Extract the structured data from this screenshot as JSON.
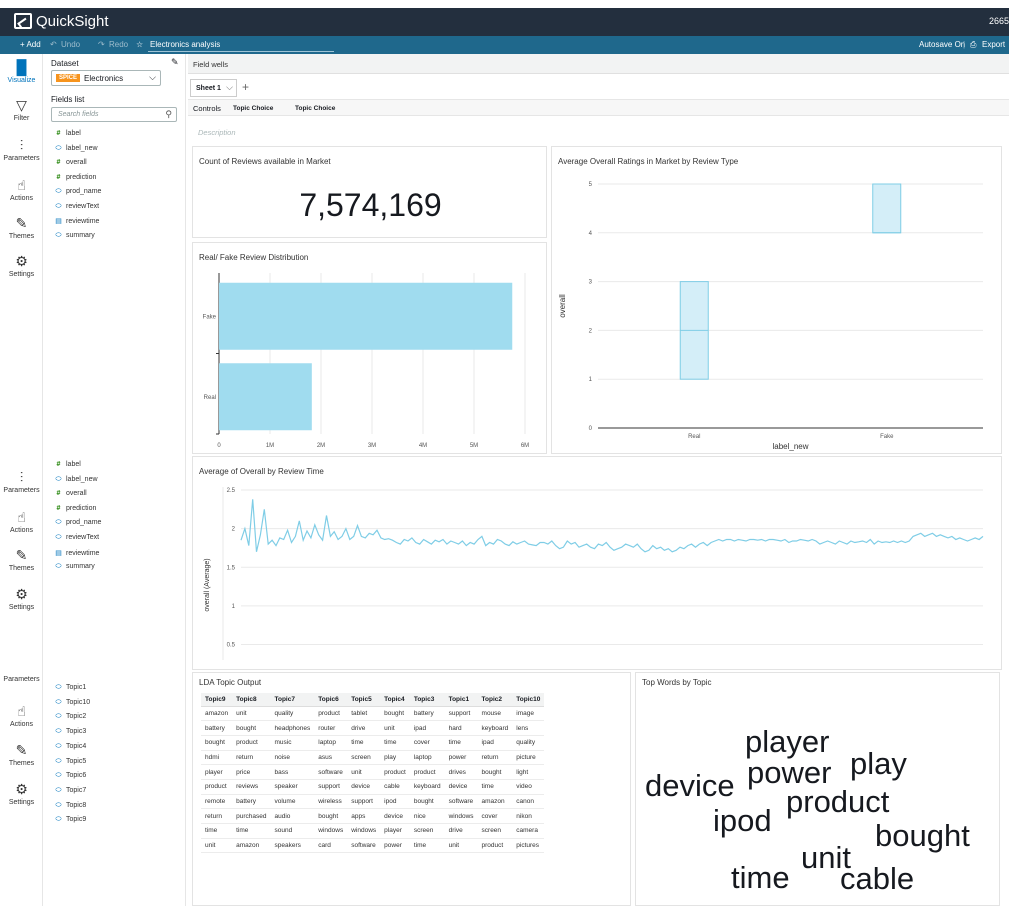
{
  "app": {
    "name": "QuickSight",
    "account": "2665"
  },
  "toolbar": {
    "add": "+ Add",
    "undo": "Undo",
    "redo": "Redo",
    "analysis_name": "Electronics analysis",
    "autosave": "Autosave On",
    "export": "Export"
  },
  "nav": [
    {
      "label": "Visualize",
      "icon": "visualize-icon"
    },
    {
      "label": "Filter",
      "icon": "filter-icon"
    },
    {
      "label": "Parameters",
      "icon": "parameters-icon"
    },
    {
      "label": "Actions",
      "icon": "actions-icon"
    },
    {
      "label": "Themes",
      "icon": "themes-icon"
    },
    {
      "label": "Settings",
      "icon": "settings-icon"
    }
  ],
  "dataset": {
    "label": "Dataset",
    "badge": "SPICE",
    "name": "Electronics"
  },
  "fields_list": {
    "label": "Fields list",
    "search_placeholder": "Search fields"
  },
  "fields": [
    {
      "name": "label",
      "type": "num"
    },
    {
      "name": "label_new",
      "type": "str"
    },
    {
      "name": "overall",
      "type": "num"
    },
    {
      "name": "prediction",
      "type": "num"
    },
    {
      "name": "prod_name",
      "type": "str"
    },
    {
      "name": "reviewText",
      "type": "str"
    },
    {
      "name": "reviewtime",
      "type": "date"
    },
    {
      "name": "summary",
      "type": "str"
    }
  ],
  "topic_fields": [
    {
      "name": "Topic1",
      "type": "str"
    },
    {
      "name": "Topic10",
      "type": "str"
    },
    {
      "name": "Topic2",
      "type": "str"
    },
    {
      "name": "Topic3",
      "type": "str"
    },
    {
      "name": "Topic4",
      "type": "str"
    },
    {
      "name": "Topic5",
      "type": "str"
    },
    {
      "name": "Topic6",
      "type": "str"
    },
    {
      "name": "Topic7",
      "type": "str"
    },
    {
      "name": "Topic8",
      "type": "str"
    },
    {
      "name": "Topic9",
      "type": "str"
    }
  ],
  "field_wells": "Field wells",
  "sheet": {
    "tab": "Sheet 1",
    "add": "+"
  },
  "controls": {
    "label": "Controls",
    "items": [
      "Topic Choice",
      "Topic Choice"
    ]
  },
  "description_placeholder": "Description",
  "colors": {
    "bar": "#a0dcef",
    "bar_stroke": "#7fcde6",
    "header": "#232f3e",
    "toolbar": "#1f688c",
    "spice": "#f7941d"
  },
  "kpi": {
    "title": "Count of Reviews available in Market",
    "value": "7,574,169"
  },
  "chart_data": [
    {
      "type": "bar",
      "orientation": "horizontal",
      "title": "Real/ Fake Review Distribution",
      "categories": [
        "Fake",
        "Real"
      ],
      "values": [
        5750000,
        1820000
      ],
      "xlim": [
        0,
        6000000
      ],
      "x_ticks": [
        "0",
        "1M",
        "2M",
        "3M",
        "4M",
        "5M",
        "6M"
      ],
      "grid": true
    },
    {
      "type": "boxplot",
      "title": "Average Overall Ratings in Market by Review Type",
      "xlabel": "label_new",
      "ylabel": "overall",
      "categories": [
        "Real",
        "Fake"
      ],
      "boxes": [
        {
          "q1": 1,
          "median": 2,
          "q3": 3
        },
        {
          "q1": 4,
          "median": 4,
          "q3": 5
        }
      ],
      "ylim": [
        0,
        5
      ],
      "y_ticks": [
        "0",
        "1",
        "2",
        "3",
        "4",
        "5"
      ],
      "grid": true
    },
    {
      "type": "line",
      "title": "Average of Overall by Review Time",
      "ylabel": "overall (Average)",
      "ylim": [
        0.3,
        2.5
      ],
      "y_ticks": [
        "0.5",
        "1",
        "1.5",
        "2",
        "2.5"
      ],
      "grid": true,
      "values": [
        1.85,
        2.0,
        1.78,
        2.38,
        1.7,
        1.92,
        2.25,
        1.8,
        1.85,
        1.78,
        1.88,
        1.86,
        1.98,
        1.82,
        1.9,
        2.1,
        1.85,
        1.97,
        1.88,
        2.05,
        1.92,
        1.85,
        2.17,
        1.9,
        1.96,
        1.86,
        1.9,
        2.0,
        1.86,
        1.9,
        2.04,
        1.9,
        1.88,
        1.94,
        1.92,
        1.98,
        1.88,
        1.86,
        1.87,
        1.85,
        1.82,
        1.8,
        1.86,
        1.84,
        1.88,
        1.82,
        1.8,
        1.86,
        1.83,
        1.8,
        1.85,
        1.83,
        1.86,
        1.8,
        1.84,
        1.82,
        1.8,
        1.84,
        1.78,
        1.82,
        1.8,
        1.86,
        1.9,
        1.78,
        1.82,
        1.8,
        1.86,
        1.84,
        1.8,
        1.78,
        1.83,
        1.8,
        1.82,
        1.84,
        1.8,
        1.79,
        1.78,
        1.82,
        1.82,
        1.8,
        1.84,
        1.78,
        1.74,
        1.76,
        1.84,
        1.8,
        1.82,
        1.76,
        1.78,
        1.8,
        1.76,
        1.74,
        1.8,
        1.78,
        1.82,
        1.76,
        1.72,
        1.74,
        1.76,
        1.8,
        1.78,
        1.76,
        1.8,
        1.74,
        1.7,
        1.72,
        1.78,
        1.74,
        1.76,
        1.72,
        1.74,
        1.7,
        1.72,
        1.76,
        1.74,
        1.78,
        1.8,
        1.76,
        1.8,
        1.82,
        1.78,
        1.82,
        1.84,
        1.86,
        1.84,
        1.86,
        1.86,
        1.84,
        1.86,
        1.85,
        1.84,
        1.86,
        1.86,
        1.85,
        1.86,
        1.84,
        1.86,
        1.86,
        1.85,
        1.84,
        1.86,
        1.82,
        1.84,
        1.84,
        1.86,
        1.85,
        1.84,
        1.86,
        1.84,
        1.8,
        1.82,
        1.84,
        1.82,
        1.8,
        1.84,
        1.82,
        1.8,
        1.84,
        1.82,
        1.83,
        1.84,
        1.82,
        1.86,
        1.8,
        1.84,
        1.82,
        1.83,
        1.82,
        1.84,
        1.82,
        1.84,
        1.82,
        1.84,
        1.9,
        1.92,
        1.94,
        1.9,
        1.92,
        1.94,
        1.9,
        1.92,
        1.9,
        1.88,
        1.9,
        1.86,
        1.88,
        1.86,
        1.84,
        1.86,
        1.88,
        1.86,
        1.9
      ]
    }
  ],
  "lda": {
    "title": "LDA Topic Output",
    "columns": [
      "Topic9",
      "Topic8",
      "Topic7",
      "Topic6",
      "Topic5",
      "Topic4",
      "Topic3",
      "Topic1",
      "Topic2",
      "Topic10"
    ],
    "rows": [
      [
        "amazon",
        "unit",
        "quality",
        "product",
        "tablet",
        "bought",
        "battery",
        "support",
        "mouse",
        "image"
      ],
      [
        "battery",
        "bought",
        "headphones",
        "router",
        "drive",
        "unit",
        "ipad",
        "hard",
        "keyboard",
        "lens"
      ],
      [
        "bought",
        "product",
        "music",
        "laptop",
        "time",
        "time",
        "cover",
        "time",
        "ipad",
        "quality"
      ],
      [
        "hdmi",
        "return",
        "noise",
        "asus",
        "screen",
        "play",
        "laptop",
        "power",
        "return",
        "picture"
      ],
      [
        "player",
        "price",
        "bass",
        "software",
        "unit",
        "product",
        "product",
        "drives",
        "bought",
        "light"
      ],
      [
        "product",
        "reviews",
        "speaker",
        "support",
        "device",
        "cable",
        "keyboard",
        "device",
        "time",
        "video"
      ],
      [
        "remote",
        "battery",
        "volume",
        "wireless",
        "support",
        "ipod",
        "bought",
        "software",
        "amazon",
        "canon"
      ],
      [
        "return",
        "purchased",
        "audio",
        "bought",
        "apps",
        "device",
        "nice",
        "windows",
        "cover",
        "nikon"
      ],
      [
        "time",
        "time",
        "sound",
        "windows",
        "windows",
        "player",
        "screen",
        "drive",
        "screen",
        "camera"
      ],
      [
        "unit",
        "amazon",
        "speakers",
        "card",
        "software",
        "power",
        "time",
        "unit",
        "product",
        "pictures"
      ]
    ]
  },
  "word_cloud": {
    "title": "Top Words by Topic",
    "words": [
      "player",
      "power",
      "play",
      "device",
      "product",
      "ipod",
      "bought",
      "unit",
      "time",
      "cable"
    ]
  }
}
